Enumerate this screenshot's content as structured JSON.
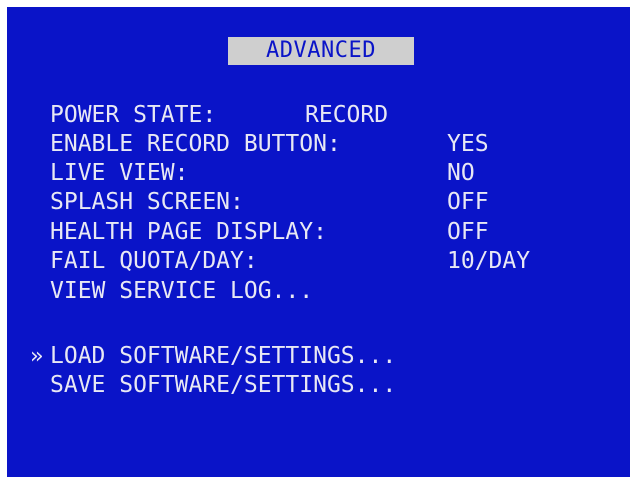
{
  "menu": {
    "title": "ADVANCED",
    "items": [
      {
        "label": "POWER STATE:",
        "value": "RECORD"
      },
      {
        "label": "ENABLE RECORD BUTTON:",
        "value": "YES"
      },
      {
        "label": "LIVE VIEW:",
        "value": "NO"
      },
      {
        "label": "SPLASH SCREEN:",
        "value": "OFF"
      },
      {
        "label": "HEALTH PAGE DISPLAY:",
        "value": "OFF"
      },
      {
        "label": "FAIL QUOTA/DAY:",
        "value": "10/DAY"
      },
      {
        "label": "VIEW SERVICE LOG..."
      }
    ],
    "actions": [
      {
        "label": "LOAD SOFTWARE/SETTINGS...",
        "selected": true
      },
      {
        "label": "SAVE SOFTWARE/SETTINGS..."
      }
    ],
    "cursor": "»"
  },
  "colors": {
    "background": "#0a14c8",
    "text": "#e8e8f4",
    "title_bg": "#cfcfcf"
  }
}
